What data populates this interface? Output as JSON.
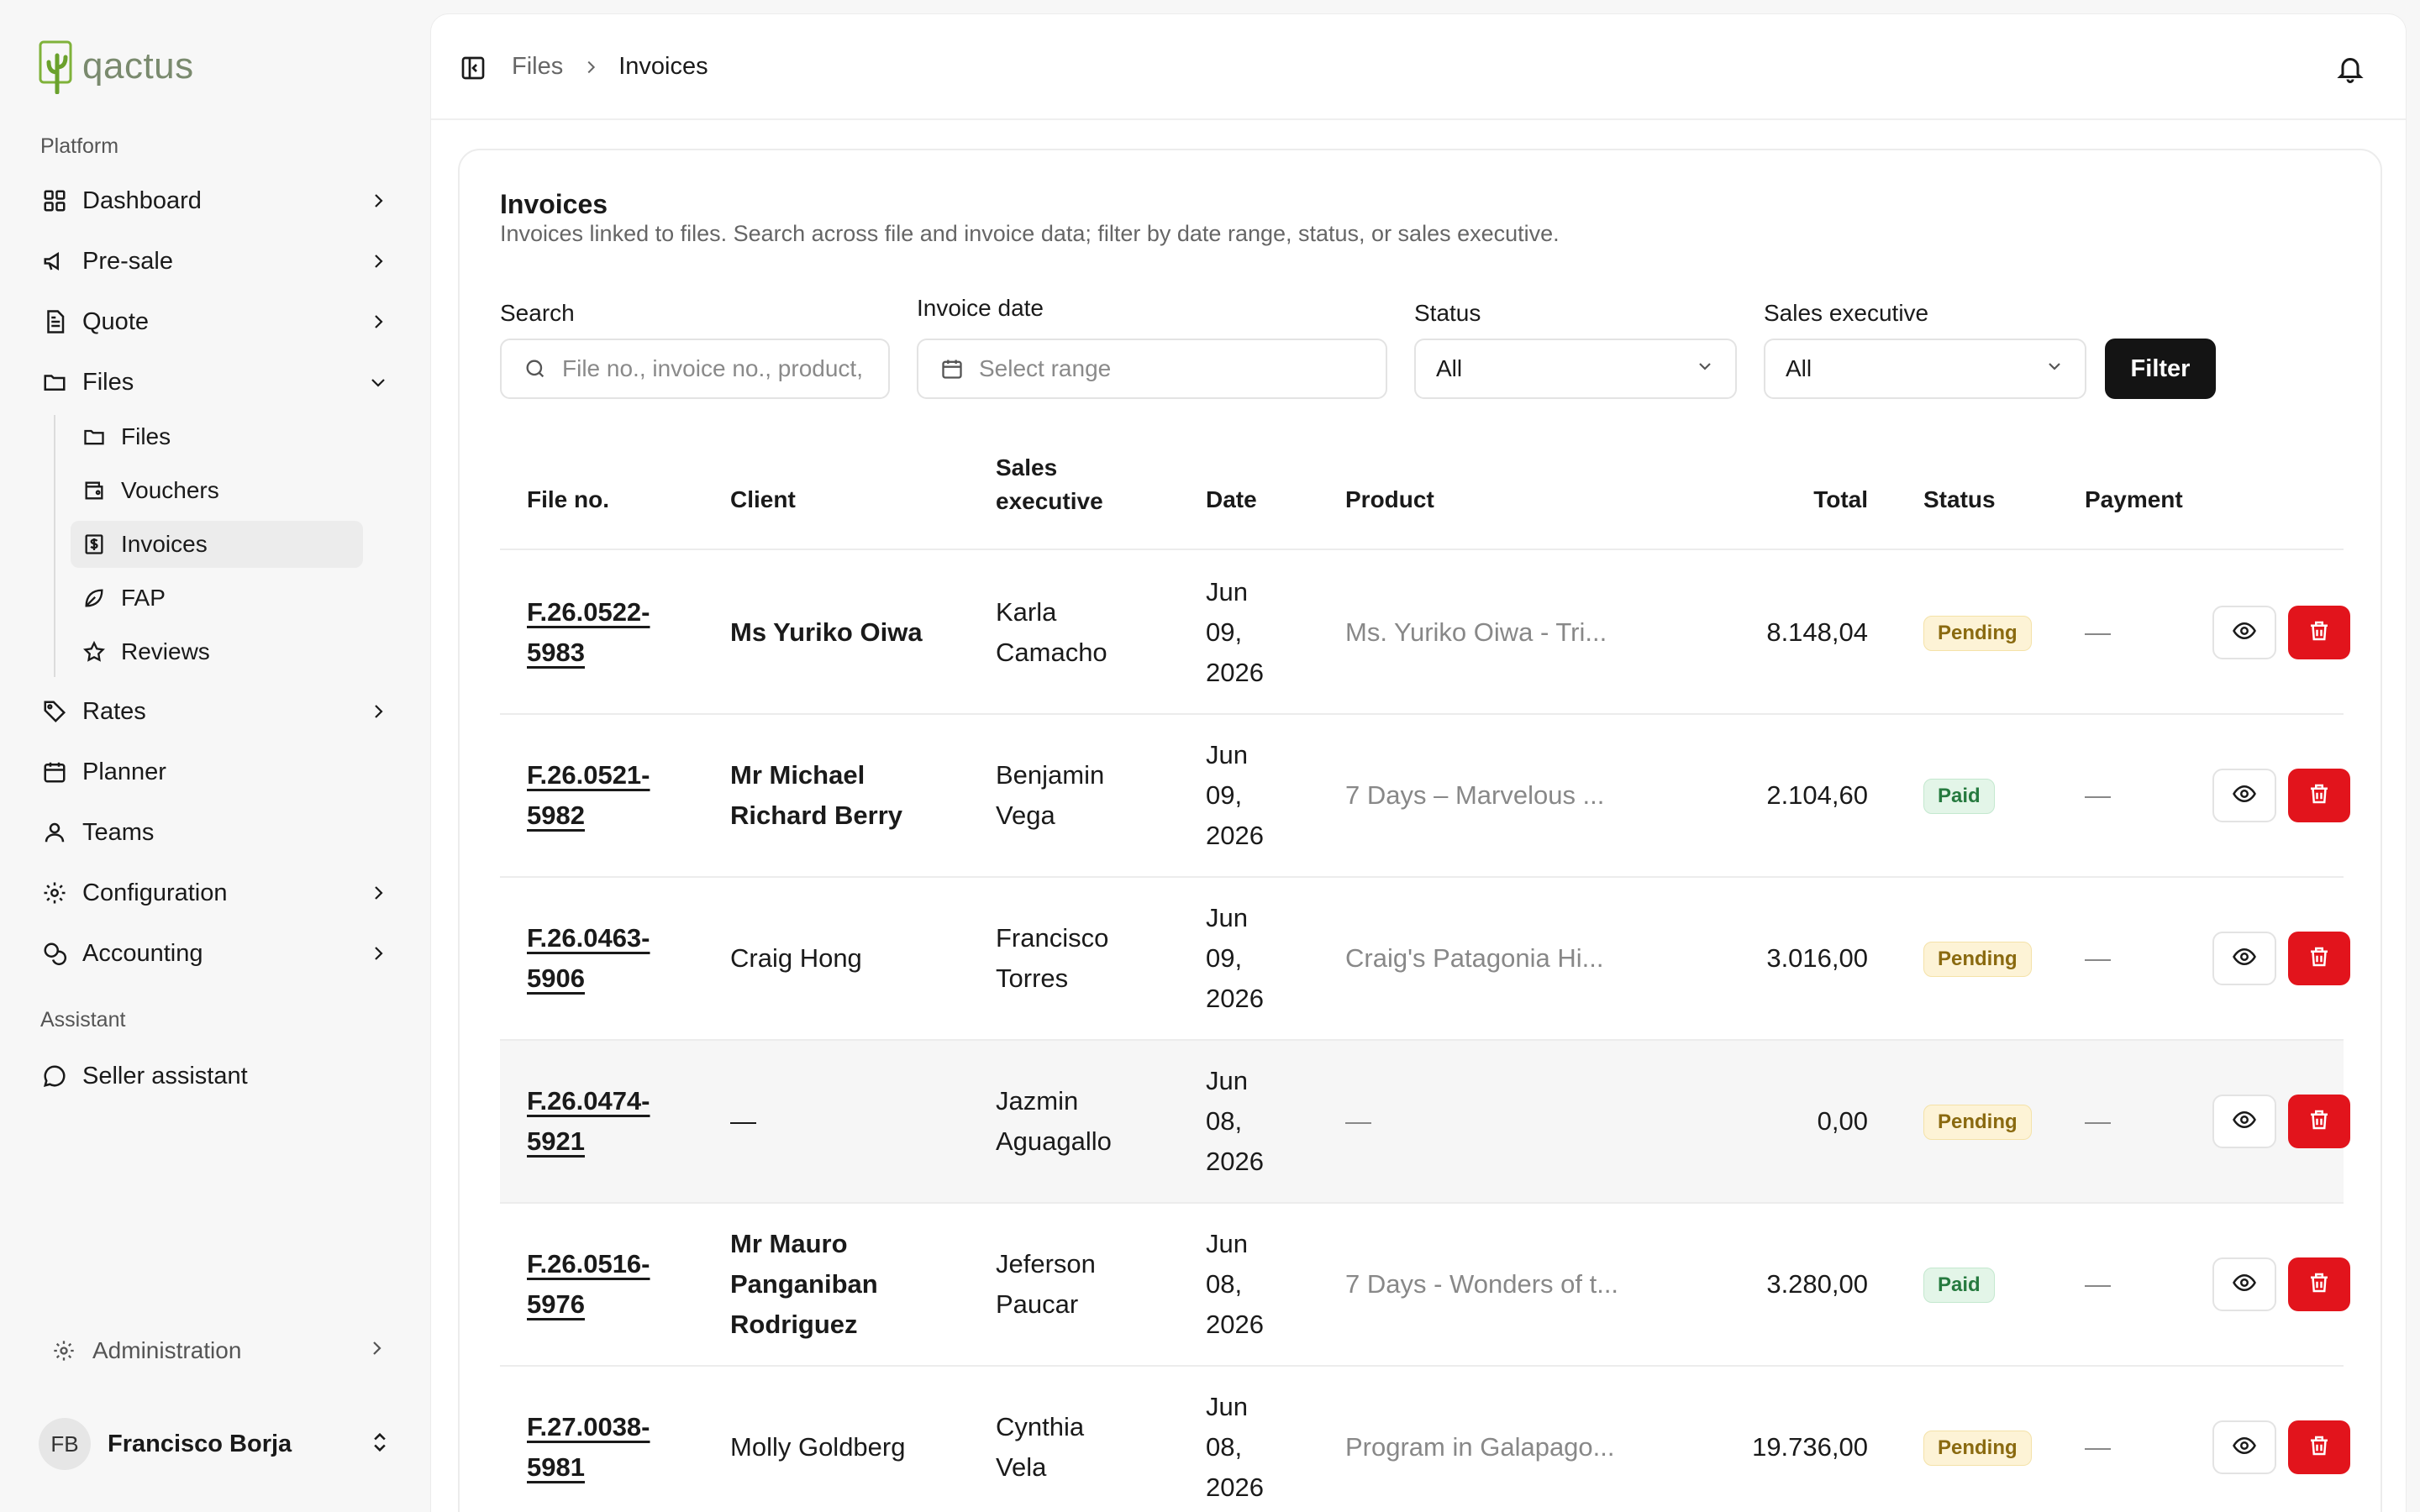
{
  "brand": {
    "name": "qactus"
  },
  "sidebar": {
    "platform_label": "Platform",
    "items": [
      {
        "label": "Dashboard",
        "icon": "grid-icon"
      },
      {
        "label": "Pre-sale",
        "icon": "megaphone-icon"
      },
      {
        "label": "Quote",
        "icon": "document-icon"
      },
      {
        "label": "Files",
        "icon": "folder-icon"
      },
      {
        "label": "Rates",
        "icon": "tag-icon"
      },
      {
        "label": "Planner",
        "icon": "calendar-icon"
      },
      {
        "label": "Teams",
        "icon": "user-icon"
      },
      {
        "label": "Configuration",
        "icon": "gear-icon"
      },
      {
        "label": "Accounting",
        "icon": "coins-icon"
      }
    ],
    "files_sub": [
      {
        "label": "Files",
        "icon": "folder-icon"
      },
      {
        "label": "Vouchers",
        "icon": "wallet-icon"
      },
      {
        "label": "Invoices",
        "icon": "invoice-icon"
      },
      {
        "label": "FAP",
        "icon": "leaf-icon"
      },
      {
        "label": "Reviews",
        "icon": "star-icon"
      }
    ],
    "assistant_label": "Assistant",
    "assistant_item": "Seller assistant",
    "admin_label": "Administration",
    "user": {
      "initials": "FB",
      "name": "Francisco Borja"
    }
  },
  "breadcrumb": {
    "parent": "Files",
    "current": "Invoices"
  },
  "page": {
    "title": "Invoices",
    "subtitle": "Invoices linked to files. Search across file and invoice data; filter by date range, status, or sales executive."
  },
  "filters": {
    "search_label": "Search",
    "search_placeholder": "File no., invoice no., product, c",
    "date_label": "Invoice date",
    "date_placeholder": "Select range",
    "status_label": "Status",
    "status_value": "All",
    "exec_label": "Sales executive",
    "exec_value": "All",
    "filter_button": "Filter"
  },
  "table": {
    "headers": {
      "file": "File no.",
      "client": "Client",
      "exec_line1": "Sales",
      "exec_line2": "executive",
      "date": "Date",
      "product": "Product",
      "total": "Total",
      "status": "Status",
      "payment": "Payment"
    },
    "rows": [
      {
        "file1": "F.26.0522-",
        "file2": "5983",
        "client1": "Ms Yuriko Oiwa",
        "client2": "",
        "client3": "",
        "exec1": "Karla",
        "exec2": "Camacho",
        "d1": "Jun",
        "d2": "09,",
        "d3": "2026",
        "product": "Ms. Yuriko Oiwa - Tri...",
        "total": "8.148,04",
        "status": "Pending",
        "payment": "—"
      },
      {
        "file1": "F.26.0521-",
        "file2": "5982",
        "client1": "Mr Michael",
        "client2": "Richard Berry",
        "client3": "",
        "exec1": "Benjamin",
        "exec2": "Vega",
        "d1": "Jun",
        "d2": "09,",
        "d3": "2026",
        "product": "7 Days – Marvelous ...",
        "total": "2.104,60",
        "status": "Paid",
        "payment": "—"
      },
      {
        "file1": "F.26.0463-",
        "file2": "5906",
        "client1": "Craig Hong",
        "client2": "",
        "client3": "",
        "exec1": "Francisco",
        "exec2": "Torres",
        "d1": "Jun",
        "d2": "09,",
        "d3": "2026",
        "product": "Craig's Patagonia Hi...",
        "total": "3.016,00",
        "status": "Pending",
        "payment": "—"
      },
      {
        "file1": "F.26.0474-",
        "file2": "5921",
        "client1": "—",
        "client2": "",
        "client3": "",
        "exec1": "Jazmin",
        "exec2": "Aguagallo",
        "d1": "Jun",
        "d2": "08,",
        "d3": "2026",
        "product": "—",
        "total": "0,00",
        "status": "Pending",
        "payment": "—"
      },
      {
        "file1": "F.26.0516-",
        "file2": "5976",
        "client1": "Mr Mauro",
        "client2": "Panganiban",
        "client3": "Rodriguez",
        "exec1": "Jeferson",
        "exec2": "Paucar",
        "d1": "Jun",
        "d2": "08,",
        "d3": "2026",
        "product": "7 Days - Wonders of t...",
        "total": "3.280,00",
        "status": "Paid",
        "payment": "—"
      },
      {
        "file1": "F.27.0038-",
        "file2": "5981",
        "client1": "Molly Goldberg",
        "client2": "",
        "client3": "",
        "exec1": "Cynthia",
        "exec2": "Vela",
        "d1": "Jun",
        "d2": "08,",
        "d3": "2026",
        "product": "Program in Galapago...",
        "total": "19.736,00",
        "status": "Pending",
        "payment": "—"
      }
    ]
  },
  "colors": {
    "accent": "#141414",
    "danger": "#e2141c",
    "pending_bg": "#fdf3d6",
    "paid_bg": "#e3f5e8"
  }
}
